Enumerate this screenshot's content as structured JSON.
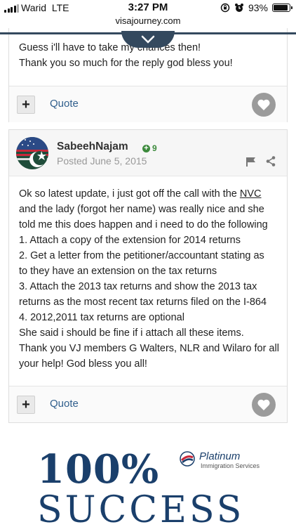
{
  "status_bar": {
    "carrier": "Warid",
    "network": "LTE",
    "time": "3:27 PM",
    "battery_text": "93%",
    "battery_level": 0.93
  },
  "browser": {
    "url": "visajourney.com"
  },
  "posts": [
    {
      "lines": [
        "Guess i'll have to take my chances then!",
        "Thank you so much for the reply god bless you!"
      ],
      "quote_label": "Quote"
    },
    {
      "username": "SabeehNajam",
      "reputation": "9",
      "posted": "Posted June 5, 2015",
      "lines": [
        "Ok so latest update, i just got off the call with the |NVC|",
        "and the lady (forgot her name) was really nice and she",
        "told me this does happen and i need to do the following",
        "1. Attach a copy of the extension for 2014 returns",
        "2. Get a letter from the petitioner/accountant stating as",
        "to they have an extension on the tax returns",
        "3. Attach the 2013 tax returns and show the 2013 tax",
        "returns as the most recent tax returns filed on the I-864",
        "4. 2012,2011 tax returns are optional",
        "She said i should be fine if i attach all these items.",
        "Thank you VJ members G Walters, NLR and Wilaro for all",
        "your help! God bless you all!"
      ],
      "quote_label": "Quote"
    }
  ],
  "ad": {
    "headline": "100%",
    "headline2": "SUCCESS",
    "brand": "Platinum",
    "brand_sub": "Immigration Services"
  },
  "colors": {
    "link": "#2f5e8c",
    "nav_dark": "#34495e",
    "rep_green": "#3c8a3c",
    "ad_navy": "#1a3f6b"
  }
}
